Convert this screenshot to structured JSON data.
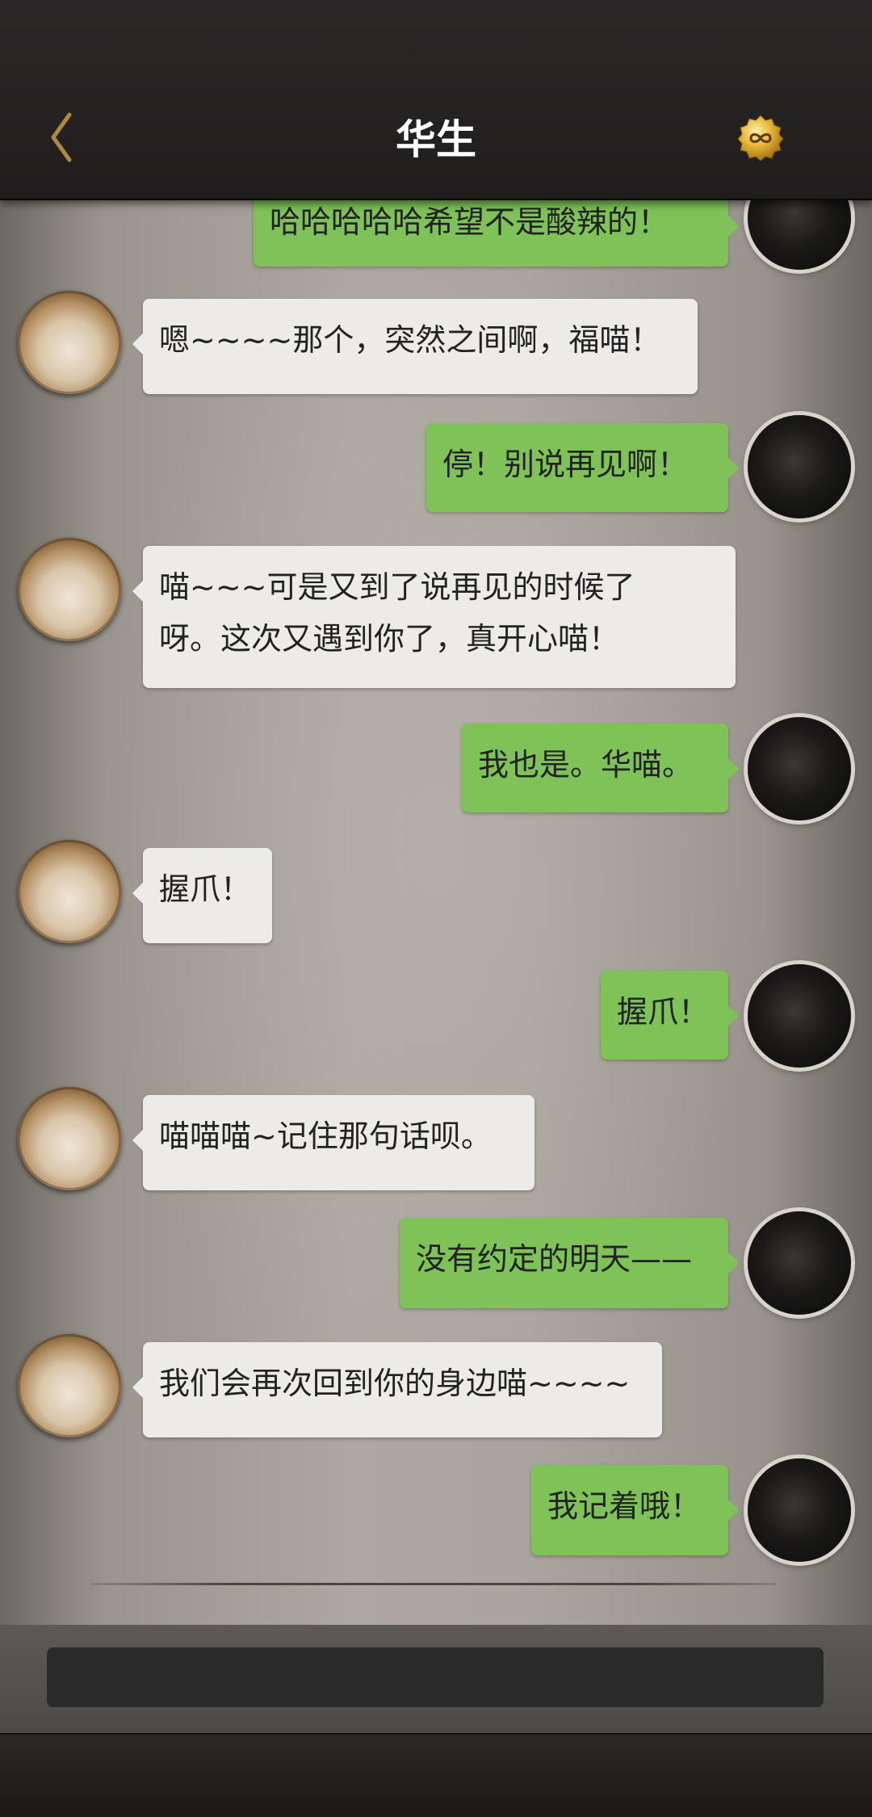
{
  "header": {
    "title": "华生",
    "back_icon": "chevron-left-icon",
    "badge_icon": "infinity-badge-icon",
    "accent_color": "#c9a23a"
  },
  "messages": [
    {
      "side": "right",
      "text": "哈哈哈哈哈希望不是酸辣的！"
    },
    {
      "side": "left",
      "text": "嗯~~~~那个，突然之间啊，福喵！"
    },
    {
      "side": "right",
      "text": "停！别说再见啊！"
    },
    {
      "side": "left",
      "lines": [
        "喵~~~可是又到了说再见的时候了",
        "呀。这次又遇到你了，真开心喵！"
      ]
    },
    {
      "side": "right",
      "text": "我也是。华喵。"
    },
    {
      "side": "left",
      "text": "握爪！"
    },
    {
      "side": "right",
      "text": "握爪！"
    },
    {
      "side": "left",
      "text": "喵喵喵~记住那句话呗。"
    },
    {
      "side": "right",
      "text": "没有约定的明天——"
    },
    {
      "side": "left",
      "text": "我们会再次回到你的身边喵~~~~"
    },
    {
      "side": "right",
      "text": "我记着哦！"
    }
  ],
  "colors": {
    "outgoing_bubble": "#7ec258",
    "incoming_bubble": "#ecebe8"
  },
  "input": {
    "value": "",
    "placeholder": ""
  }
}
